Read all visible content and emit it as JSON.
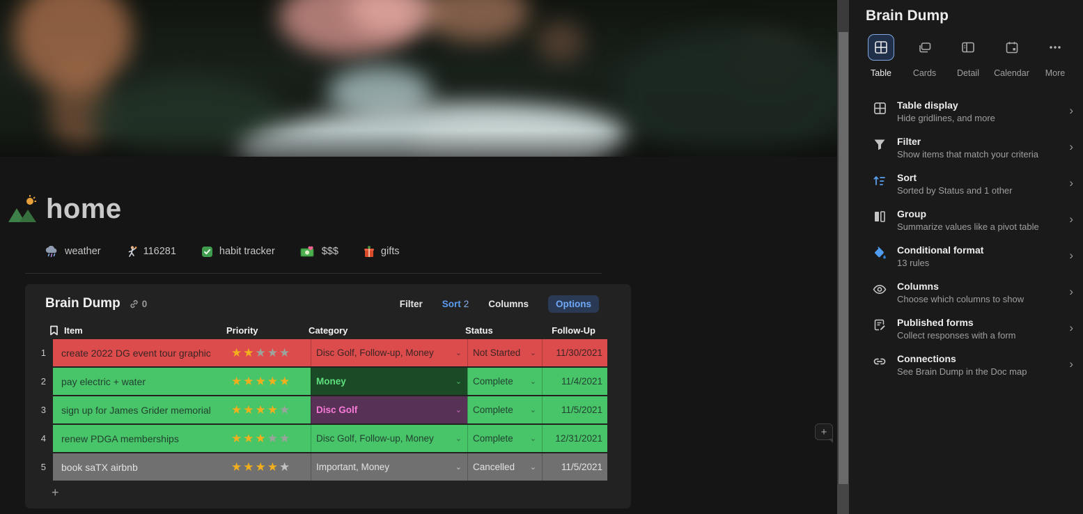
{
  "page": {
    "title": "home",
    "quick_links": [
      {
        "icon": "storm-cloud-icon",
        "label": "weather"
      },
      {
        "icon": "person-throwing-icon",
        "label": "116281"
      },
      {
        "icon": "checkbox-icon",
        "label": "habit tracker"
      },
      {
        "icon": "money-heart-icon",
        "label": "$$$"
      },
      {
        "icon": "gift-icon",
        "label": "gifts"
      }
    ]
  },
  "table": {
    "title": "Brain Dump",
    "link_count": "0",
    "toolbar": {
      "filter": "Filter",
      "sort": "Sort",
      "sort_count": "2",
      "columns": "Columns",
      "options": "Options"
    },
    "column_headers": {
      "item": "Item",
      "priority": "Priority",
      "category": "Category",
      "status": "Status",
      "followup": "Follow-Up"
    },
    "add_row_label": "+",
    "rows": [
      {
        "num": "1",
        "item": "create 2022 DG event tour graphic",
        "priority": 2,
        "category": "Disc Golf, Follow-up, Money",
        "status": "Not Started",
        "followup": "11/30/2021",
        "row_bg": "#DD4C4C",
        "text": "#3b2424"
      },
      {
        "num": "2",
        "item": "pay electric + water",
        "priority": 5,
        "category": "Money",
        "status": "Complete",
        "followup": "11/4/2021",
        "row_bg": "#47C568",
        "text": "#234031",
        "cat_bg": "#1B4A26",
        "cat_text": "#5EE07D",
        "cat_bold": true
      },
      {
        "num": "3",
        "item": "sign up for James Grider memorial",
        "priority": 4,
        "category": "Disc Golf",
        "status": "Complete",
        "followup": "11/5/2021",
        "row_bg": "#47C568",
        "text": "#234031",
        "cat_bg": "#573156",
        "cat_text": "#F97AD8",
        "cat_bold": true
      },
      {
        "num": "4",
        "item": "renew PDGA memberships",
        "priority": 3,
        "category": "Disc Golf, Follow-up, Money",
        "status": "Complete",
        "followup": "12/31/2021",
        "row_bg": "#47C568",
        "text": "#234031"
      },
      {
        "num": "5",
        "item": "book saTX airbnb",
        "priority": 4,
        "category": "Important, Money",
        "status": "Cancelled",
        "followup": "11/5/2021",
        "row_bg": "#707070",
        "text": "#e2e2e2",
        "star_empty": "#c2c2c2"
      }
    ],
    "star_gold": "#F2AF1D",
    "star_empty": "#9CA39C"
  },
  "sidebar": {
    "title": "Brain Dump",
    "tabs": [
      {
        "icon": "table-view-icon",
        "label": "Table",
        "selected": true
      },
      {
        "icon": "cards-view-icon",
        "label": "Cards",
        "selected": false
      },
      {
        "icon": "detail-view-icon",
        "label": "Detail",
        "selected": false
      },
      {
        "icon": "calendar-view-icon",
        "label": "Calendar",
        "selected": false
      },
      {
        "icon": "more-dots-icon",
        "label": "More",
        "selected": false
      }
    ],
    "options": [
      {
        "icon": "table-grid-icon",
        "title": "Table display",
        "subtitle": "Hide gridlines, and more"
      },
      {
        "icon": "filter-funnel-icon",
        "title": "Filter",
        "subtitle": "Show items that match your criteria"
      },
      {
        "icon": "sort-icon",
        "title": "Sort",
        "subtitle": "Sorted by Status and 1 other"
      },
      {
        "icon": "group-columns-icon",
        "title": "Group",
        "subtitle": "Summarize values like a pivot table"
      },
      {
        "icon": "paint-bucket-icon",
        "title": "Conditional format",
        "subtitle": "13 rules"
      },
      {
        "icon": "eye-icon",
        "title": "Columns",
        "subtitle": "Choose which columns to show"
      },
      {
        "icon": "form-doc-icon",
        "title": "Published forms",
        "subtitle": "Collect responses with a form"
      },
      {
        "icon": "chain-link-icon",
        "title": "Connections",
        "subtitle": "See Brain Dump in the Doc map"
      }
    ],
    "chevron": "›"
  }
}
